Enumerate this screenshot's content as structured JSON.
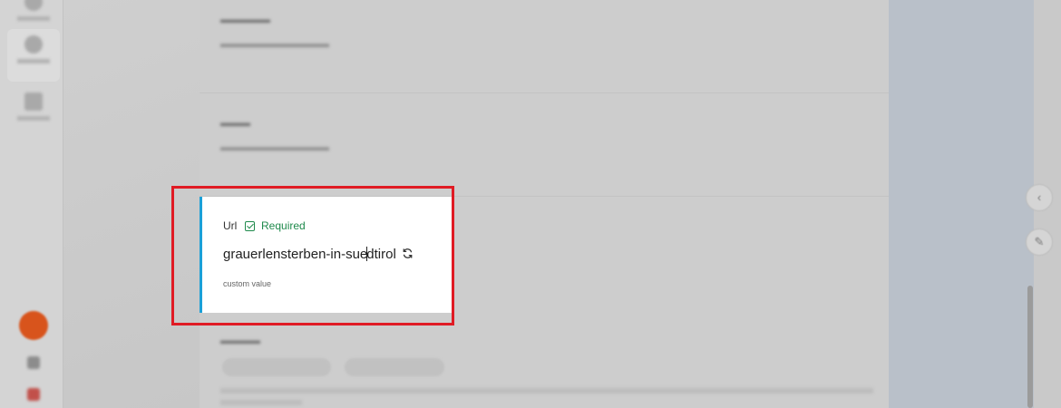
{
  "field": {
    "label": "Url",
    "required_label": "Required",
    "value_before_caret": "grauerlensterben-in-sue",
    "value_after_caret": "dtirol",
    "hint": "custom value"
  },
  "icons": {
    "required": "checkbox-checked-icon",
    "regenerate": "refresh-icon"
  },
  "colors": {
    "accent_bar": "#1aa0d8",
    "required_green": "#1f8a4c",
    "highlight_red": "#e01b24"
  }
}
